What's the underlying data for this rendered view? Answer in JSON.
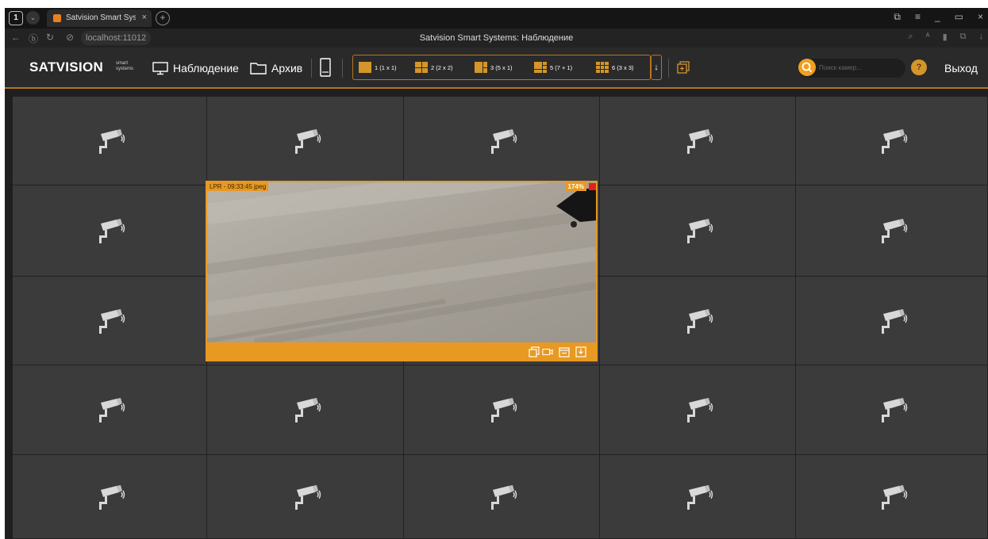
{
  "browser": {
    "tab_count": "1",
    "tab_title": "Satvision Smart Systems",
    "url": "localhost:11012",
    "page_title": "Satvision Smart Systems: Наблюдение"
  },
  "toolbar": {
    "logo": "SATVISION",
    "logo_sub_1": "smart",
    "logo_sub_2": "systems",
    "nav_live": "Наблюдение",
    "nav_archive": "Архив",
    "layouts": [
      {
        "label": "1 (1 x 1)"
      },
      {
        "label": "2 (2 x 2)"
      },
      {
        "label": "3 (5 x 1)"
      },
      {
        "label": "5 (7 + 1)"
      },
      {
        "label": "6 (3 x 3)"
      }
    ],
    "layout_more": "↓",
    "search_placeholder": "Поиск камер...",
    "logout": "Выход"
  },
  "active_view": {
    "caption": "LPR - 09:33:45 jpeg",
    "zoom": "174%"
  },
  "colors": {
    "accent": "#e89922",
    "record": "#e02020",
    "cell": "#3b3b3b"
  }
}
